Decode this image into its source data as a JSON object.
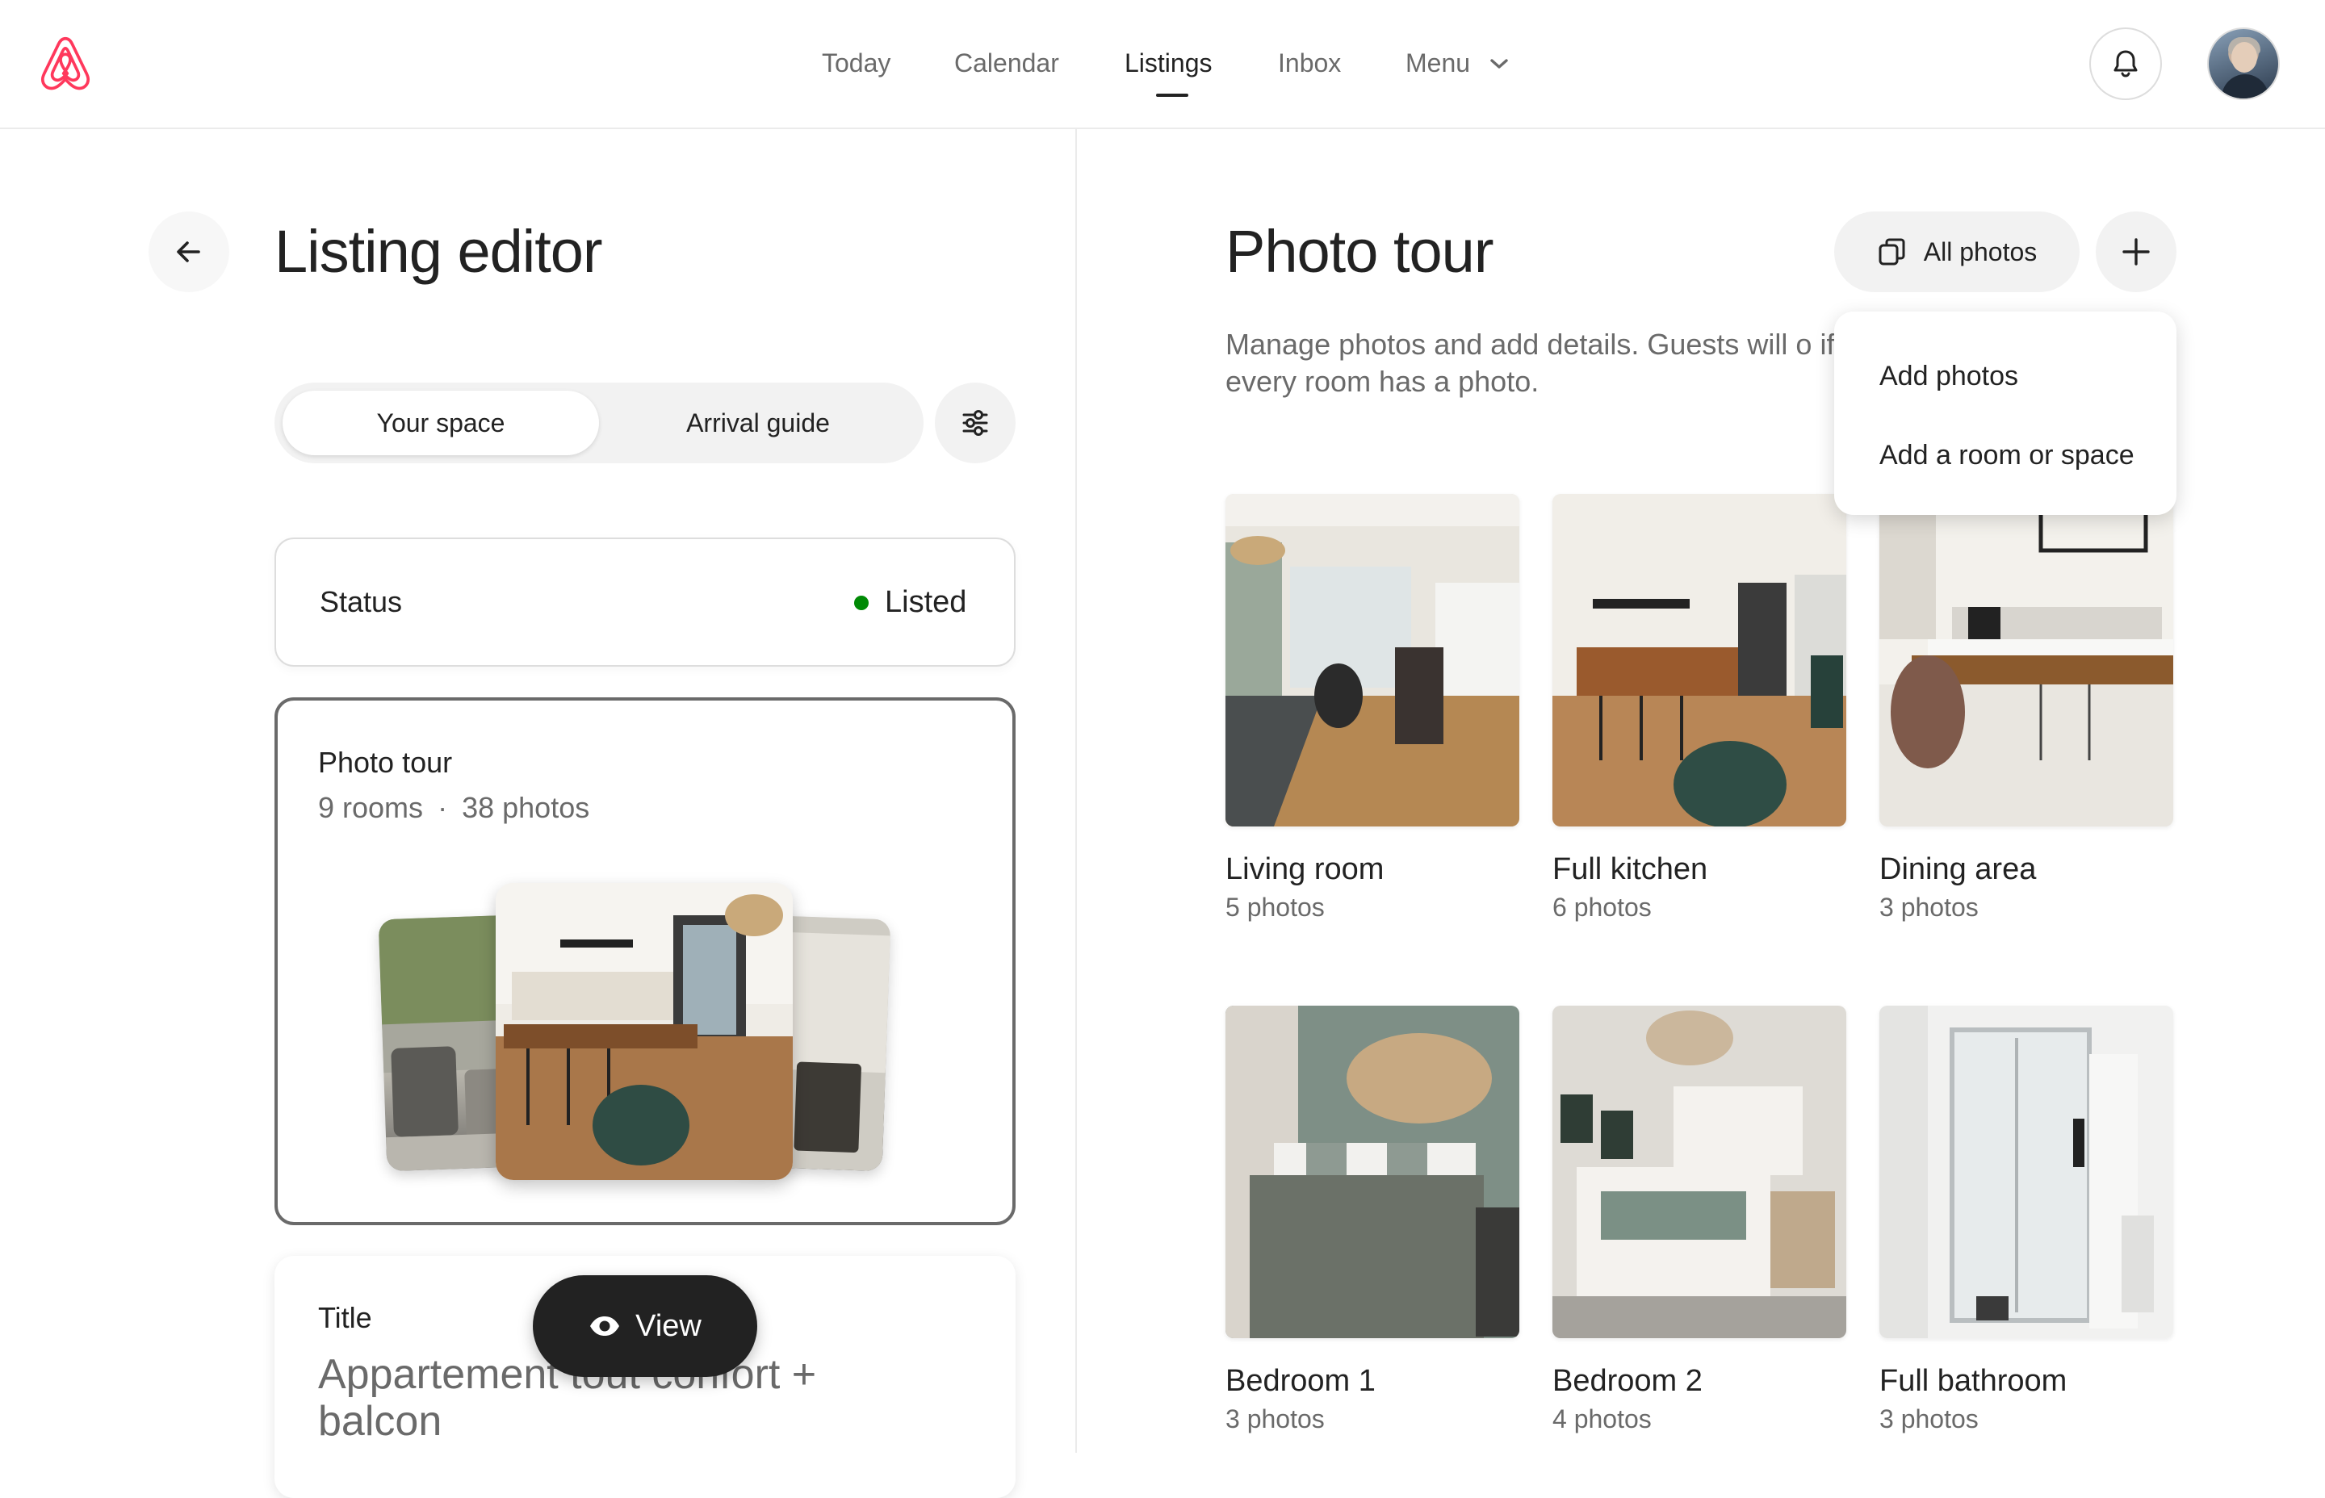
{
  "nav": {
    "items": [
      "Today",
      "Calendar",
      "Listings",
      "Inbox",
      "Menu"
    ],
    "active": "Listings"
  },
  "editor": {
    "title": "Listing editor",
    "tabs": {
      "your_space": "Your space",
      "arrival_guide": "Arrival guide"
    },
    "status": {
      "label": "Status",
      "value": "Listed",
      "color": "#008a05"
    },
    "photo_tour_card": {
      "title": "Photo tour",
      "rooms": "9 rooms",
      "separator": "·",
      "photos": "38 photos"
    },
    "title_card": {
      "label": "Title",
      "value": "Appartement tout confort + balcon"
    },
    "view_button": "View"
  },
  "photo_tour": {
    "title": "Photo tour",
    "description": "Manage photos and add details. Guests will o if every room has a photo.",
    "all_photos_button": "All photos",
    "dropdown": [
      "Add photos",
      "Add a room or space"
    ],
    "rooms": [
      {
        "name": "Living room",
        "count": "5 photos"
      },
      {
        "name": "Full kitchen",
        "count": "6 photos"
      },
      {
        "name": "Dining area",
        "count": "3 photos"
      },
      {
        "name": "Bedroom 1",
        "count": "3 photos"
      },
      {
        "name": "Bedroom 2",
        "count": "4 photos"
      },
      {
        "name": "Full bathroom",
        "count": "3 photos"
      }
    ]
  },
  "colors": {
    "brand": "#FF385C",
    "text": "#222222",
    "muted": "#6a6a6a"
  }
}
